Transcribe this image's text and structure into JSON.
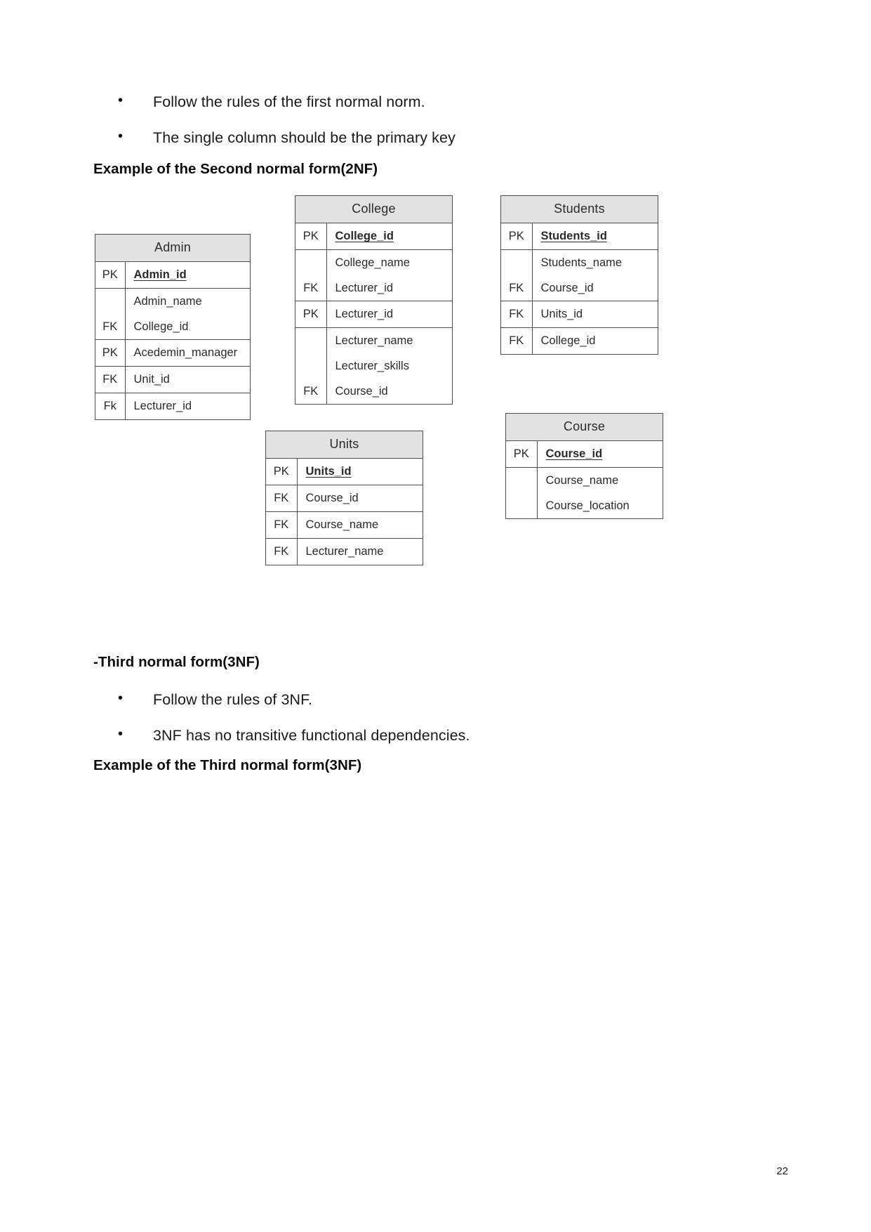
{
  "document": {
    "page_number": "22",
    "intro_bullets": [
      "Follow the rules of the first normal norm.",
      "The single column should be the primary key"
    ],
    "heading_2nf": "Example of the Second normal form(2NF)",
    "heading_3nf": "-Third normal form(3NF)",
    "bullets_3nf": [
      "Follow the rules of 3NF.",
      "3NF has no transitive functional dependencies."
    ],
    "heading_3nf_example": "Example of the Third normal form(3NF)"
  },
  "diagram": {
    "entities": [
      {
        "name": "Admin",
        "rows": [
          {
            "keys": [
              "PK"
            ],
            "fields": [
              "Admin_id"
            ],
            "underline": true
          },
          {
            "keys": [
              "",
              "FK"
            ],
            "fields": [
              "Admin_name",
              "College_id"
            ],
            "underline": false
          },
          {
            "keys": [
              "PK"
            ],
            "fields": [
              "Acedemin_manager"
            ],
            "underline": false
          },
          {
            "keys": [
              "FK"
            ],
            "fields": [
              "Unit_id"
            ],
            "underline": false
          },
          {
            "keys": [
              "Fk"
            ],
            "fields": [
              "Lecturer_id"
            ],
            "underline": false
          }
        ]
      },
      {
        "name": "College",
        "rows": [
          {
            "keys": [
              "PK"
            ],
            "fields": [
              "College_id"
            ],
            "underline": true
          },
          {
            "keys": [
              "",
              "FK"
            ],
            "fields": [
              "College_name",
              "Lecturer_id"
            ],
            "underline": false
          },
          {
            "keys": [
              "PK"
            ],
            "fields": [
              "Lecturer_id"
            ],
            "underline": false
          },
          {
            "keys": [
              "",
              "",
              "FK"
            ],
            "fields": [
              "Lecturer_name",
              "Lecturer_skills",
              "Course_id"
            ],
            "underline": false
          }
        ]
      },
      {
        "name": "Students",
        "rows": [
          {
            "keys": [
              "PK"
            ],
            "fields": [
              "Students_id"
            ],
            "underline": true
          },
          {
            "keys": [
              "",
              "FK"
            ],
            "fields": [
              "Students_name",
              "Course_id"
            ],
            "underline": false
          },
          {
            "keys": [
              "FK"
            ],
            "fields": [
              "Units_id"
            ],
            "underline": false
          },
          {
            "keys": [
              "FK"
            ],
            "fields": [
              "College_id"
            ],
            "underline": false
          }
        ]
      },
      {
        "name": "Units",
        "rows": [
          {
            "keys": [
              "PK"
            ],
            "fields": [
              "Units_id"
            ],
            "underline": true
          },
          {
            "keys": [
              "FK"
            ],
            "fields": [
              "Course_id"
            ],
            "underline": false
          },
          {
            "keys": [
              "FK"
            ],
            "fields": [
              "Course_name"
            ],
            "underline": false
          },
          {
            "keys": [
              "FK"
            ],
            "fields": [
              "Lecturer_name"
            ],
            "underline": false
          }
        ]
      },
      {
        "name": "Course",
        "rows": [
          {
            "keys": [
              "PK"
            ],
            "fields": [
              "Course_id"
            ],
            "underline": true
          },
          {
            "keys": [
              "",
              ""
            ],
            "fields": [
              "Course_name",
              "Course_location"
            ],
            "underline": false
          }
        ]
      }
    ]
  }
}
